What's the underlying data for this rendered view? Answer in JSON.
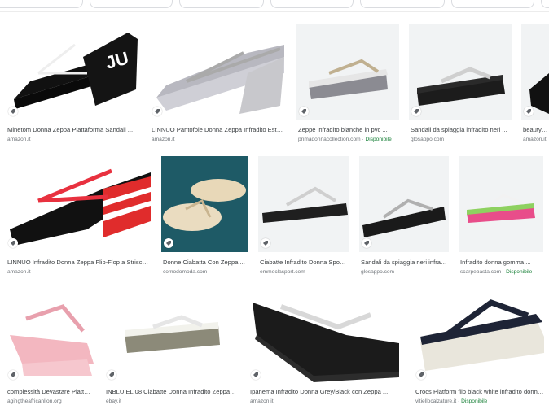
{
  "results": [
    {
      "title": "Minetom Donna Zeppa Piattaforma Sandali ...",
      "source": "amazon.it",
      "availability": ""
    },
    {
      "title": "LINNUO Pantofole Donna Zeppa Infradito Estate ...",
      "source": "amazon.it",
      "availability": ""
    },
    {
      "title": "Zeppe infradito bianche in pvc ...",
      "source": "primadonnacollection.com",
      "availability": "Disponibile"
    },
    {
      "title": "Sandali da spiaggia infradito neri ...",
      "source": "glosappo.com",
      "availability": ""
    },
    {
      "title": "beautyjoy ...",
      "source": "amazon.it",
      "availability": ""
    },
    {
      "title": "LINNUO Infradito Donna Zeppa Flip-Flop a Strisce ...",
      "source": "amazon.it",
      "availability": ""
    },
    {
      "title": "Donne Ciabatta Con Zeppa ...",
      "source": "comodomoda.com",
      "availability": ""
    },
    {
      "title": "Ciabatte Infradito Donna Sport ...",
      "source": "emmeclasport.com",
      "availability": ""
    },
    {
      "title": "Sandali da spiaggia neri infradito ...",
      "source": "glosappo.com",
      "availability": ""
    },
    {
      "title": "Infradito donna gomma ...",
      "source": "scarpebasta.com",
      "availability": "Disponibile"
    },
    {
      "title": "complessità Devastare Piattaforma ...",
      "source": "agingtheafricanlion.org",
      "availability": ""
    },
    {
      "title": "INBLU EL 08 Ciabatte Donna Infradito Zeppa ...",
      "source": "ebay.it",
      "availability": ""
    },
    {
      "title": "Ipanema Infradito Donna Grey/Black con Zeppa ...",
      "source": "amazon.it",
      "availability": ""
    },
    {
      "title": "Crocs Platform flip black white infradito donna ...",
      "source": "vitiellocalzature.it",
      "availability": "Disponibile"
    }
  ],
  "colors": {
    "thumb_bg": "#f1f3f4",
    "caption": "#3c4043",
    "source": "#70757a",
    "available": "#188038"
  },
  "icons": {
    "badge": "tag-icon"
  }
}
